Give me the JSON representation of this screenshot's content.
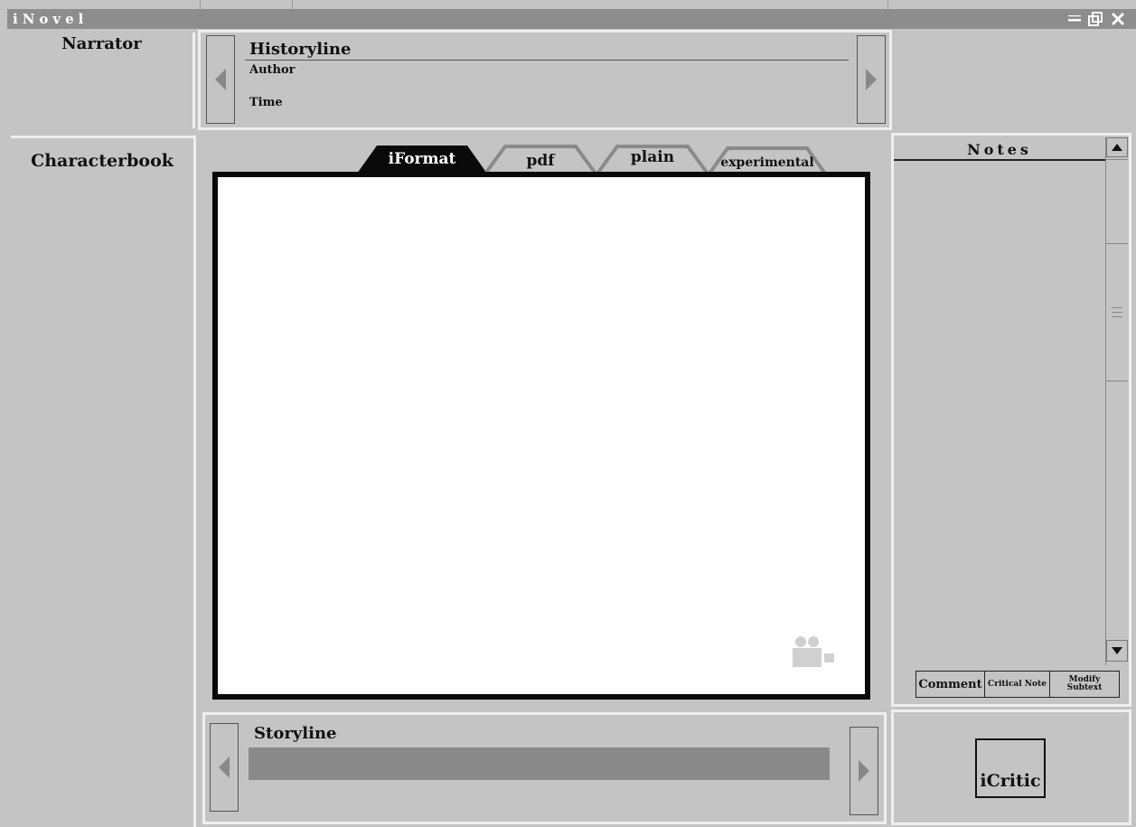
{
  "window": {
    "title": "iNovel",
    "controls": [
      "minimize-icon",
      "restore-icon",
      "close-icon"
    ]
  },
  "narrator": {
    "label": "Narrator"
  },
  "historyline": {
    "title": "Historyline",
    "author_label": "Author",
    "time_label": "Time"
  },
  "characterbook": {
    "label": "Characterbook"
  },
  "editor": {
    "tabs": [
      {
        "label": "iFormat",
        "active": true
      },
      {
        "label": "pdf",
        "active": false
      },
      {
        "label": "plain",
        "active": false
      },
      {
        "label": "experimental",
        "active": false
      }
    ],
    "icon": "video-camera-icon"
  },
  "notes": {
    "title": "Notes",
    "actions": [
      {
        "label": "Comment"
      },
      {
        "label": "Critical Note"
      },
      {
        "label": "Modify Subtext"
      }
    ]
  },
  "storyline": {
    "title": "Storyline"
  },
  "icritic": {
    "label": "iCritic"
  },
  "colors": {
    "background": "#c4c4c4",
    "title_strip": "#8d8d8d",
    "panel_border": "#efefef",
    "active_tab": "#0a0a0a",
    "inactive_tab_outline": "#8a8a8a",
    "storyline_bar": "#8a8a8a"
  }
}
